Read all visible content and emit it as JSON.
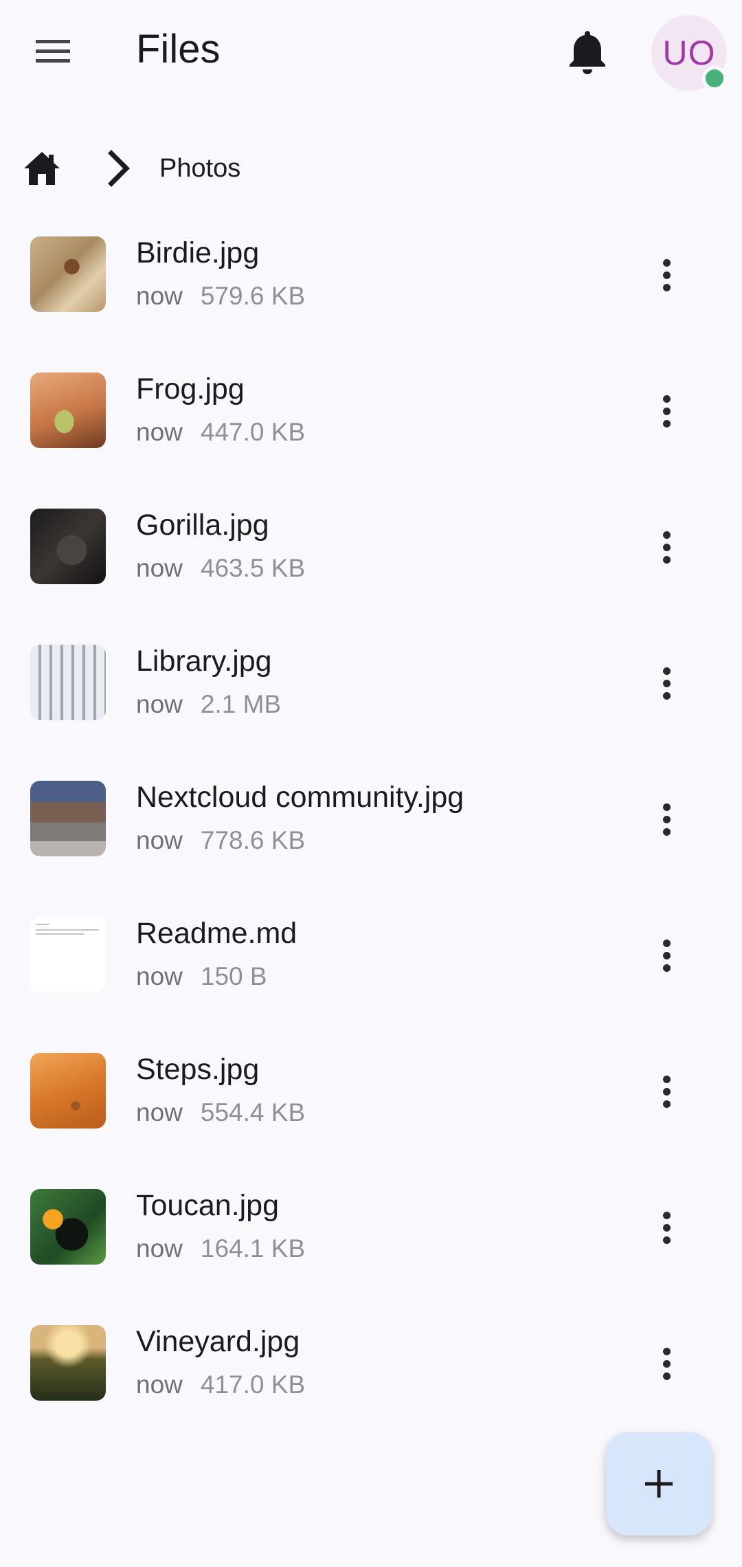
{
  "app": {
    "title": "Files"
  },
  "header": {
    "avatar_initials": "UO",
    "status_color": "#49b27a"
  },
  "breadcrumb": {
    "current": "Photos"
  },
  "files": [
    {
      "name": "Birdie.jpg",
      "date": "now",
      "size": "579.6 KB",
      "thumb": "birdie"
    },
    {
      "name": "Frog.jpg",
      "date": "now",
      "size": "447.0 KB",
      "thumb": "frog"
    },
    {
      "name": "Gorilla.jpg",
      "date": "now",
      "size": "463.5 KB",
      "thumb": "gorilla"
    },
    {
      "name": "Library.jpg",
      "date": "now",
      "size": "2.1 MB",
      "thumb": "library"
    },
    {
      "name": "Nextcloud community.jpg",
      "date": "now",
      "size": "778.6 KB",
      "thumb": "community"
    },
    {
      "name": "Readme.md",
      "date": "now",
      "size": "150 B",
      "thumb": "readme"
    },
    {
      "name": "Steps.jpg",
      "date": "now",
      "size": "554.4 KB",
      "thumb": "steps"
    },
    {
      "name": "Toucan.jpg",
      "date": "now",
      "size": "164.1 KB",
      "thumb": "toucan"
    },
    {
      "name": "Vineyard.jpg",
      "date": "now",
      "size": "417.0 KB",
      "thumb": "vineyard"
    }
  ],
  "icons": {
    "menu": "menu-icon",
    "notifications": "bell-icon",
    "home": "home-icon",
    "separator": "chevron-right-icon",
    "more": "more-vert-icon",
    "add": "plus-icon"
  },
  "colors": {
    "background": "#f9f9fd",
    "fab": "#d8e6fb",
    "avatar_bg": "#f3e6f3",
    "avatar_text": "#a03aa6"
  }
}
